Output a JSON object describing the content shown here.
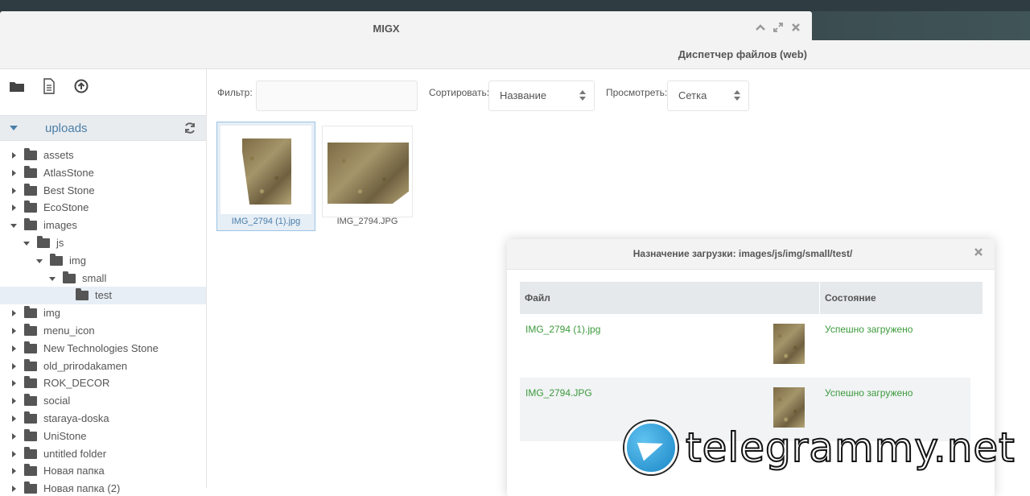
{
  "window": {
    "title": "MIGX",
    "controls": {
      "collapse": "collapse-icon",
      "maximize": "maximize-icon",
      "close": "close-icon"
    }
  },
  "file_manager": {
    "title": "Диспетчер файлов (web)"
  },
  "tree_toolbar": {
    "icons": [
      "folder-icon",
      "file-icon",
      "upload-icon"
    ]
  },
  "tree": {
    "root_label": "uploads",
    "nodes": [
      {
        "label": "assets",
        "depth": 0,
        "state": "closed"
      },
      {
        "label": "AtlasStone",
        "depth": 0,
        "state": "closed"
      },
      {
        "label": "Best Stone",
        "depth": 0,
        "state": "closed"
      },
      {
        "label": "EcoStone",
        "depth": 0,
        "state": "closed"
      },
      {
        "label": "images",
        "depth": 0,
        "state": "open"
      },
      {
        "label": "js",
        "depth": 1,
        "state": "open"
      },
      {
        "label": "img",
        "depth": 2,
        "state": "open"
      },
      {
        "label": "small",
        "depth": 3,
        "state": "open"
      },
      {
        "label": "test",
        "depth": 4,
        "state": "leaf",
        "selected": true
      },
      {
        "label": "img",
        "depth": 0,
        "state": "closed"
      },
      {
        "label": "menu_icon",
        "depth": 0,
        "state": "closed"
      },
      {
        "label": "New Technologies Stone",
        "depth": 0,
        "state": "closed"
      },
      {
        "label": "old_prirodakamen",
        "depth": 0,
        "state": "closed"
      },
      {
        "label": "ROK_DECOR",
        "depth": 0,
        "state": "closed"
      },
      {
        "label": "social",
        "depth": 0,
        "state": "closed"
      },
      {
        "label": "staraya-doska",
        "depth": 0,
        "state": "closed"
      },
      {
        "label": "UniStone",
        "depth": 0,
        "state": "closed"
      },
      {
        "label": "untitled folder",
        "depth": 0,
        "state": "closed"
      },
      {
        "label": "Новая папка",
        "depth": 0,
        "state": "closed"
      },
      {
        "label": "Новая папка (2)",
        "depth": 0,
        "state": "closed"
      }
    ]
  },
  "filter_bar": {
    "filter_label": "Фильтр:",
    "filter_value": "",
    "sort_label": "Сортировать:",
    "sort_value": "Название",
    "view_label": "Просмотреть:",
    "view_value": "Сетка"
  },
  "files": [
    {
      "name": "IMG_2794 (1).jpg",
      "selected": true
    },
    {
      "name": "IMG_2794.JPG",
      "selected": false
    }
  ],
  "upload_dialog": {
    "title": "Назначение загрузки: images/js/img/small/test/",
    "col_file": "Файл",
    "col_status": "Состояние",
    "rows": [
      {
        "file": "IMG_2794 (1).jpg",
        "status": "Успешно загружено"
      },
      {
        "file": "IMG_2794.JPG",
        "status": "Успешно загружено"
      }
    ]
  },
  "watermark": {
    "text": "telegrammy.net"
  },
  "colors": {
    "accent": "#4a7ea8",
    "success": "#3c9a3c",
    "header_bg": "#f3f3f3"
  }
}
